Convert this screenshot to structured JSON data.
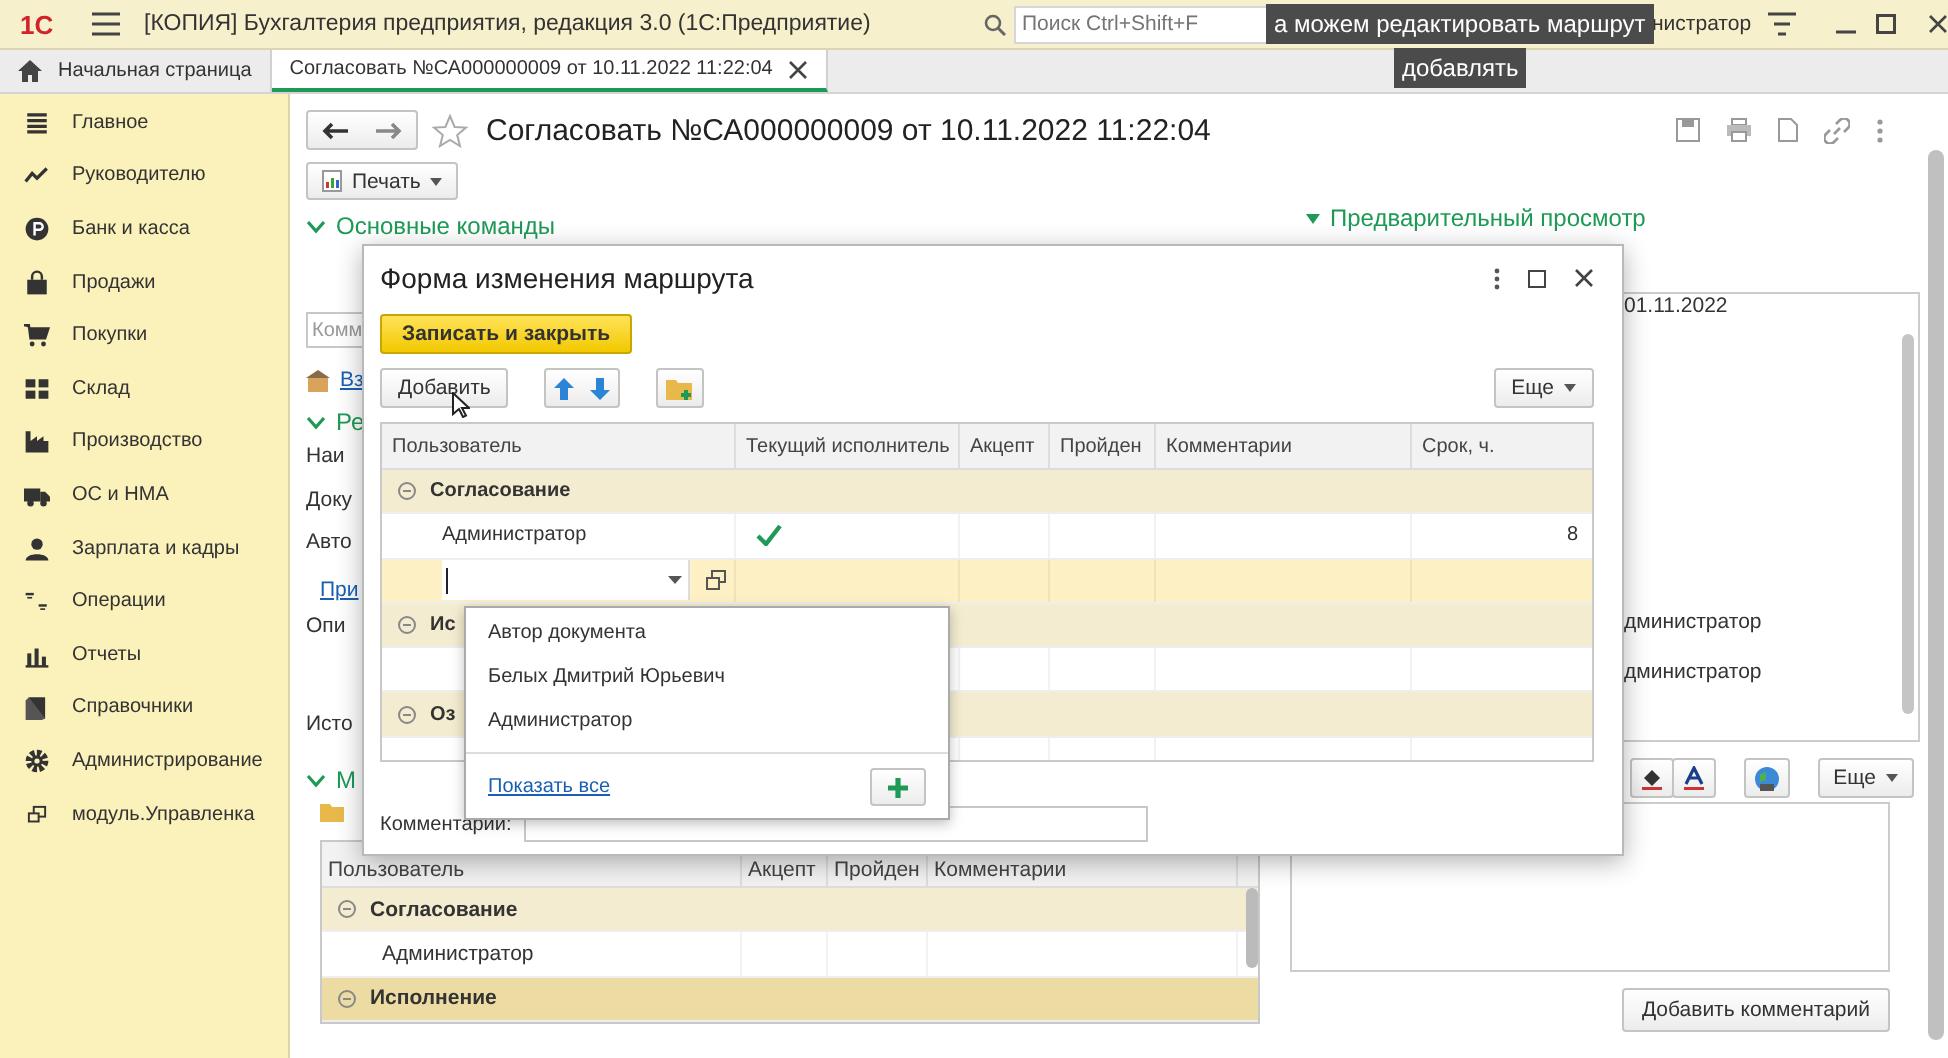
{
  "app": {
    "logo": "1С",
    "title": "[КОПИЯ] Бухгалтерия предприятия, редакция 3.0  (1С:Предприятие)",
    "search": {
      "placeholder": "Поиск Ctrl+Shift+F"
    },
    "user": "нистратор"
  },
  "video_captions": [
    "а можем редактировать маршрут",
    "добавлять"
  ],
  "tabs": [
    {
      "label": "Начальная страница",
      "selected": false
    },
    {
      "label": "Согласовать №СА000000009 от 10.11.2022 11:22:04",
      "selected": true
    }
  ],
  "sidebar": {
    "items": [
      {
        "label": "Главное"
      },
      {
        "label": "Руководителю"
      },
      {
        "label": "Банк и касса"
      },
      {
        "label": "Продажи"
      },
      {
        "label": "Покупки"
      },
      {
        "label": "Склад"
      },
      {
        "label": "Производство"
      },
      {
        "label": "ОС и НМА"
      },
      {
        "label": "Зарплата и кадры"
      },
      {
        "label": "Операции"
      },
      {
        "label": "Отчеты"
      },
      {
        "label": "Справочники"
      },
      {
        "label": "Администрирование"
      },
      {
        "label": "модуль.Управленка"
      }
    ]
  },
  "document": {
    "title": "Согласовать №СА000000009 от 10.11.2022 11:22:04",
    "print_button": "Печать",
    "main_commands": "Основные команды",
    "comment_field": {
      "placeholder": "Комм"
    },
    "link_1": "Вз",
    "section_2": "Ре",
    "labels": [
      "Наи",
      "Доку",
      "Авто"
    ],
    "link_2": "При",
    "label_4": "Опи",
    "label_5": "Исто",
    "section_3": "М",
    "route_table": {
      "columns": [
        "Пользователь",
        "Акцепт",
        "Пройден",
        "Комментарии"
      ],
      "rows": [
        {
          "kind": "group",
          "user": "Согласование",
          "selected": false
        },
        {
          "kind": "user",
          "user": "Администратор",
          "selected": false
        },
        {
          "kind": "group",
          "user": "Исполнение",
          "selected": true
        }
      ]
    }
  },
  "preview": {
    "title": "Предварительный просмотр",
    "lines": [
      "01.11.2022",
      "дминистратор",
      "дминистратор"
    ],
    "more_button": "Еще",
    "add_comment_button": "Добавить комментарий"
  },
  "dialog": {
    "title": "Форма изменения маршрута",
    "save_button": "Записать и закрыть",
    "add_button": "Добавить",
    "more_button": "Еще",
    "columns": [
      "Пользователь",
      "Текущий исполнитель",
      "Акцепт",
      "Пройден",
      "Комментарии",
      "Срок, ч."
    ],
    "rows": [
      {
        "kind": "group",
        "user": "Согласование",
        "selected": false
      },
      {
        "kind": "user",
        "user": "Администратор",
        "current": true,
        "term": "8",
        "selected": false
      },
      {
        "kind": "input",
        "selected": true
      },
      {
        "kind": "group",
        "user": "Ис",
        "selected": false
      },
      {
        "kind": "user",
        "selected": false
      },
      {
        "kind": "group",
        "user": "Оз",
        "selected": false
      },
      {
        "kind": "user",
        "selected": false
      }
    ],
    "comment_label": "Комментарии:",
    "dropdown": {
      "items": [
        "Автор документа",
        "Белых Дмитрий Юрьевич",
        "Администратор"
      ],
      "show_all": "Показать все"
    }
  }
}
